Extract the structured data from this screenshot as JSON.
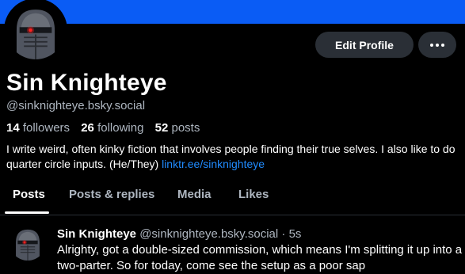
{
  "profile": {
    "display_name": "Sin Knighteye",
    "handle": "@sinknighteye.bsky.social",
    "stats": {
      "followers_count": "14",
      "followers_label": "followers",
      "following_count": "26",
      "following_label": "following",
      "posts_count": "52",
      "posts_label": "posts"
    },
    "bio_text": "I write weird, often kinky fiction that involves people finding their true selves. I also like to do quarter circle inputs. (He/They) ",
    "bio_link": "linktr.ee/sinknighteye"
  },
  "header": {
    "edit_profile_label": "Edit Profile",
    "more_icon": "ellipsis-icon",
    "banner_color": "#0a5cf5"
  },
  "tabs": [
    {
      "label": "Posts",
      "active": true
    },
    {
      "label": "Posts & replies",
      "active": false
    },
    {
      "label": "Media",
      "active": false
    },
    {
      "label": "Likes",
      "active": false
    }
  ],
  "post": {
    "author_name": "Sin Knighteye",
    "author_handle": "@sinknighteye.bsky.social",
    "separator": "·",
    "time": "5s",
    "text": "Alrighty, got a double-sized commission, which means I'm splitting it up into a two-parter. So for today, come see the setup as a poor sap"
  },
  "colors": {
    "accent": "#208bfe",
    "button_bg": "#2a2f36",
    "muted_text": "#aeb6c0"
  }
}
